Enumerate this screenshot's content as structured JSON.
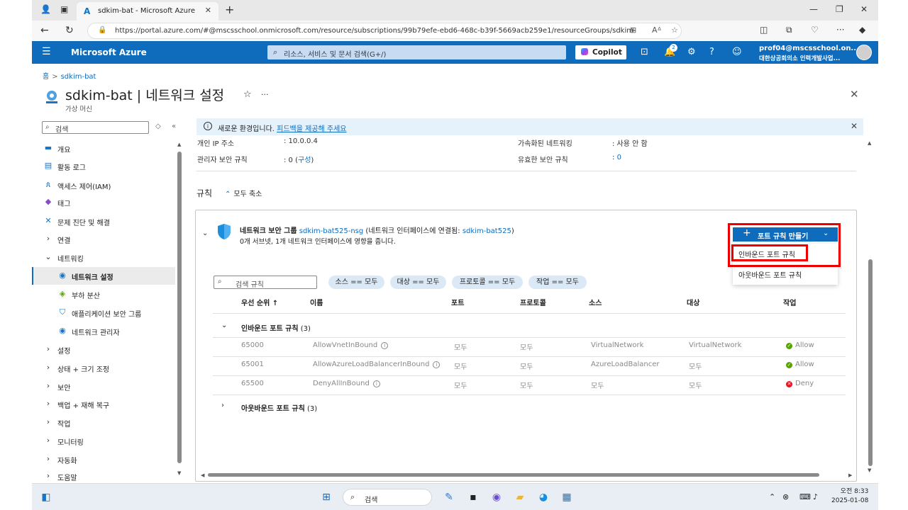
{
  "browser": {
    "tab_title": "sdkim-bat - Microsoft Azure",
    "url": "https://portal.azure.com/#@mscsschool.onmicrosoft.com/resource/subscriptions/99b79efe-ebd6-468c-b39f-5669acb259e1/resourceGroups/sdkim-rg/provi..."
  },
  "header": {
    "brand": "Microsoft Azure",
    "search_placeholder": "리소스, 서비스 및 문서 검색(G+/)",
    "copilot": "Copilot",
    "notification_count": "2",
    "account_email": "prof04@mscsschool.on...",
    "account_org": "대한상공회의소 인력개발사업..."
  },
  "breadcrumb": {
    "home": "홈",
    "resource": "sdkim-bat"
  },
  "page": {
    "title": "sdkim-bat | 네트워크 설정",
    "subtitle": "가상 머신"
  },
  "sidebar": {
    "search_placeholder": "검색",
    "items": [
      {
        "label": "개요",
        "icon": "monitor-icon"
      },
      {
        "label": "활동 로그",
        "icon": "log-icon"
      },
      {
        "label": "액세스 제어(IAM)",
        "icon": "people-icon"
      },
      {
        "label": "태그",
        "icon": "tag-icon"
      },
      {
        "label": "문제 진단 및 해결",
        "icon": "wrench-icon"
      },
      {
        "label": "연결",
        "icon": "chevron-right-icon"
      },
      {
        "label": "네트워킹",
        "icon": "chevron-down-icon"
      },
      {
        "label": "네트워크 설정",
        "icon": "network-icon"
      },
      {
        "label": "부하 분산",
        "icon": "load-balancer-icon"
      },
      {
        "label": "애플리케이션 보안 그룹",
        "icon": "shield-icon"
      },
      {
        "label": "네트워크 관리자",
        "icon": "network-manager-icon"
      },
      {
        "label": "설정",
        "icon": "chevron-right-icon"
      },
      {
        "label": "상태 + 크기 조정",
        "icon": "chevron-right-icon"
      },
      {
        "label": "보안",
        "icon": "chevron-right-icon"
      },
      {
        "label": "백업 + 재해 복구",
        "icon": "chevron-right-icon"
      },
      {
        "label": "작업",
        "icon": "chevron-right-icon"
      },
      {
        "label": "모니터링",
        "icon": "chevron-right-icon"
      },
      {
        "label": "자동화",
        "icon": "chevron-right-icon"
      },
      {
        "label": "도움말",
        "icon": "chevron-right-icon"
      }
    ]
  },
  "banner": {
    "text": "새로운 환경입니다. ",
    "link": "피드백을 제공해 주세요"
  },
  "properties": {
    "private_ip_label": "개인 IP 주소",
    "private_ip_value": ": 10.0.0.4",
    "admin_rules_label": "관리자 보안 규칙",
    "admin_rules_value": ": 0 (",
    "admin_rules_link": "구성",
    "admin_rules_close": ")",
    "accel_label": "가속화된 네트워킹",
    "accel_value": ": 사용 안 함",
    "effective_label": "유효한 보안 규칙",
    "effective_prefix": ":",
    "effective_link": "0"
  },
  "rules_section": {
    "title": "규칙",
    "collapse_all": "모두 축소"
  },
  "nsg": {
    "prefix": "네트워크 보안 그룹",
    "name": "sdkim-bat525-nsg",
    "attached_text": "(네트워크 인터페이스에 연결됨:",
    "nic": "sdkim-bat525",
    "attached_close": ")",
    "summary": "0개 서브넷, 1개 네트워크 인터페이스에 영향을 줍니다."
  },
  "create_button": {
    "label": "포트 규칙 만들기"
  },
  "dropdown": {
    "inbound": "인바운드 포트 규칙",
    "outbound": "아웃바운드 포트 규칙"
  },
  "filters": {
    "search_placeholder": "검색 규칙",
    "pills": [
      "소스 == 모두",
      "대상 == 모두",
      "프로토콜 == 모두",
      "작업 == 모두"
    ]
  },
  "table": {
    "headers": [
      "우선 순위 ↑",
      "이름",
      "포트",
      "프로토콜",
      "소스",
      "대상",
      "작업"
    ],
    "inbound_group": "인바운드 포트 규칙",
    "inbound_count": "(3)",
    "outbound_group": "아웃바운드 포트 규칙",
    "outbound_count": "(3)",
    "rows": [
      {
        "priority": "65000",
        "name": "AllowVnetInBound",
        "port": "모두",
        "protocol": "모두",
        "source": "VirtualNetwork",
        "dest": "VirtualNetwork",
        "action": "Allow",
        "action_color": "#57a300"
      },
      {
        "priority": "65001",
        "name": "AllowAzureLoadBalancerInBound",
        "port": "모두",
        "protocol": "모두",
        "source": "AzureLoadBalancer",
        "dest": "모두",
        "action": "Allow",
        "action_color": "#57a300"
      },
      {
        "priority": "65500",
        "name": "DenyAllInBound",
        "port": "모두",
        "protocol": "모두",
        "source": "모두",
        "dest": "모두",
        "action": "Deny",
        "action_color": "#e81123"
      }
    ]
  },
  "taskbar": {
    "search": "검색",
    "time": "오전 8:33",
    "date": "2025-01-08"
  }
}
